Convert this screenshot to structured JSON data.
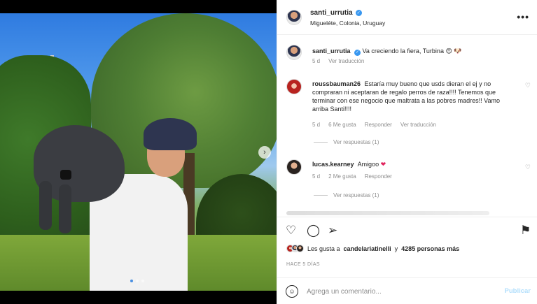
{
  "post": {
    "username": "santi_urrutia",
    "location": "Migueléte, Colonia, Uruguay",
    "caption": "Va creciendo la fiera, Turbina 😍 🐶",
    "caption_time": "5 d",
    "see_translation": "Ver traducción",
    "more_label": "•••"
  },
  "media": {
    "next_icon": "›",
    "carousel_count": 3,
    "carousel_active": 0
  },
  "comments": [
    {
      "username": "roussbauman26",
      "text": "Estaría muy bueno que usds dieran el ej y no compraran ni aceptaran de regalo perros de raza!!!! Tenemos que terminar con ese negocio que maltrata a las pobres madres!! Vamo arriba Santi!!!!",
      "time": "5 d",
      "likes": "6 Me gusta",
      "reply": "Responder",
      "translate": "Ver traducción",
      "view_replies": "Ver respuestas (1)"
    },
    {
      "username": "lucas.kearney",
      "text": "Amigoo",
      "time": "5 d",
      "likes": "2 Me gusta",
      "reply": "Responder",
      "view_replies": "Ver respuestas (1)"
    }
  ],
  "likes": {
    "prefix": "Les gusta a",
    "user": "candelariatinelli",
    "joiner": "y",
    "others": "4285 personas más"
  },
  "date": "HACE 5 DÍAS",
  "compose": {
    "placeholder": "Agrega un comentario...",
    "publish": "Publicar"
  },
  "colors": {
    "verified": "#3897f0",
    "publish_disabled": "#b2dffc",
    "meta_gray": "#8e8e8e"
  }
}
